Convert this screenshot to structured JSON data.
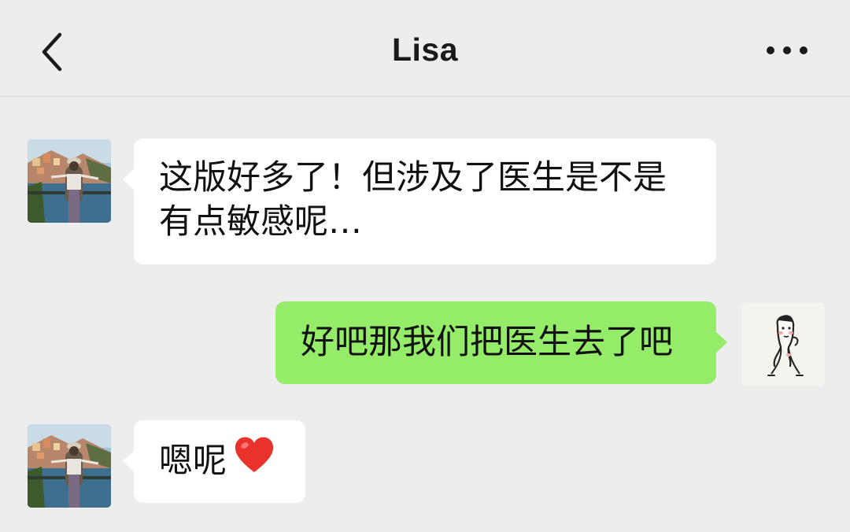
{
  "header": {
    "title": "Lisa",
    "back_icon": "chevron-left-icon",
    "more_icon": "more-dots-icon"
  },
  "messages": [
    {
      "direction": "incoming",
      "sender": "Lisa",
      "text": "这版好多了！但涉及了医生是不是有点敏感呢…"
    },
    {
      "direction": "outgoing",
      "sender": "me",
      "text": "好吧那我们把医生去了吧"
    },
    {
      "direction": "incoming",
      "sender": "Lisa",
      "text": "嗯呢",
      "emoji": "red-heart-icon"
    }
  ],
  "colors": {
    "background": "#ededed",
    "incoming_bubble": "#ffffff",
    "outgoing_bubble": "#95ec69",
    "heart": "#e8322b"
  }
}
